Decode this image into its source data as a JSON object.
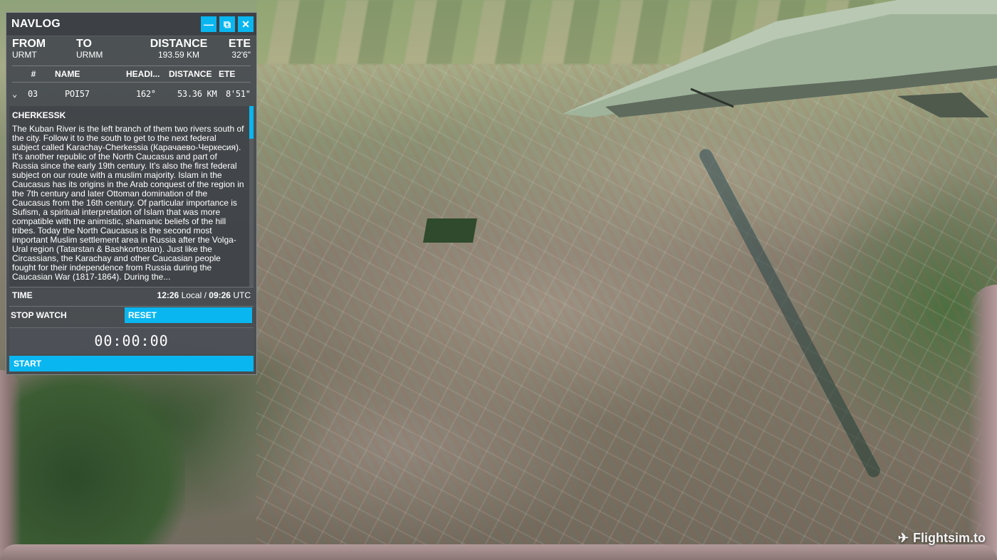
{
  "window": {
    "title": "NAVLOG",
    "buttons": {
      "minimize": "—",
      "popout": "⧉",
      "close": "✕"
    }
  },
  "summary": {
    "from_label": "FROM",
    "from_value": "URMT",
    "to_label": "TO",
    "to_value": "URMM",
    "distance_label": "DISTANCE",
    "distance_value": "193.59 KM",
    "ete_label": "ETE",
    "ete_value": "32'6\""
  },
  "table": {
    "headers": [
      "#",
      "NAME",
      "HEADI...",
      "DISTANCE",
      "ETE"
    ],
    "rows": [
      {
        "expand": "⌄",
        "num": "03",
        "name": "POI57",
        "heading": "162°",
        "distance": "53.36 KM",
        "ete": "8'51\""
      }
    ]
  },
  "description": {
    "title": "CHERKESSK",
    "body": "The Kuban River is the left branch of them two rivers south of the city. Follow it to the south to get to the next federal subject called Karachay-Cherkessia (Карачаево-Черкесия). It's another republic of the North Caucasus and part of Russia since the early 19th century. It's also the first federal subject on our route with a muslim majority. Islam in the Caucasus has its origins in the Arab conquest of the region in the 7th century and later Ottoman domination of the Caucasus from the 16th century. Of particular importance is Sufism, a spiritual interpretation of Islam that was more compatible with the animistic, shamanic beliefs of the hill tribes. Today the North Caucasus is the second most important Muslim settlement area in Russia after the Volga-Ural region (Tatarstan & Bashkortostan). Just like the Circassians, the Karachay and other Caucasian people fought for their independence from Russia during the Caucasian War (1817-1864). During the..."
  },
  "time": {
    "label": "TIME",
    "local": "12:26",
    "local_suffix": "Local /",
    "utc": "09:26",
    "utc_suffix": "UTC"
  },
  "stopwatch": {
    "label": "STOP WATCH",
    "reset_label": "RESET",
    "display": "00:00:00",
    "start_label": "START"
  },
  "watermark": "Flightsim.to",
  "colors": {
    "accent": "#0ab6f0",
    "panel_bg": "#464a50"
  }
}
